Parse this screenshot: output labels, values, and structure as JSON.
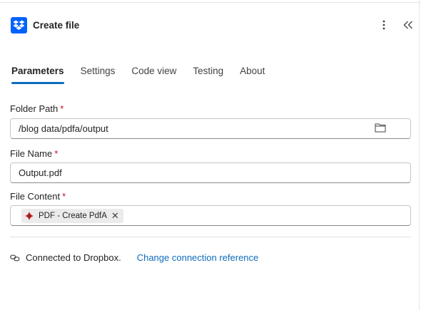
{
  "header": {
    "title": "Create file",
    "app_icon": "dropbox-icon",
    "more_icon": "more-vertical-icon",
    "collapse_icon": "collapse-chevrons-icon"
  },
  "tabs": [
    {
      "label": "Parameters",
      "active": true
    },
    {
      "label": "Settings",
      "active": false
    },
    {
      "label": "Code view",
      "active": false
    },
    {
      "label": "Testing",
      "active": false
    },
    {
      "label": "About",
      "active": false
    }
  ],
  "fields": {
    "folder_path": {
      "label": "Folder Path",
      "required_mark": "*",
      "value": "/blog data/pdfa/output",
      "icon": "folder-icon"
    },
    "file_name": {
      "label": "File Name",
      "required_mark": "*",
      "value": "Output.pdf"
    },
    "file_content": {
      "label": "File Content",
      "required_mark": "*",
      "token": {
        "label": "PDF - Create PdfA",
        "icon": "pdf-action-icon",
        "close_glyph": "✕"
      }
    }
  },
  "connection": {
    "icon": "link-icon",
    "text": "Connected to Dropbox.",
    "link": "Change connection reference"
  },
  "colors": {
    "accent": "#0f6cbd",
    "dropbox_brand": "#0061fe",
    "required": "#c50f1f"
  }
}
